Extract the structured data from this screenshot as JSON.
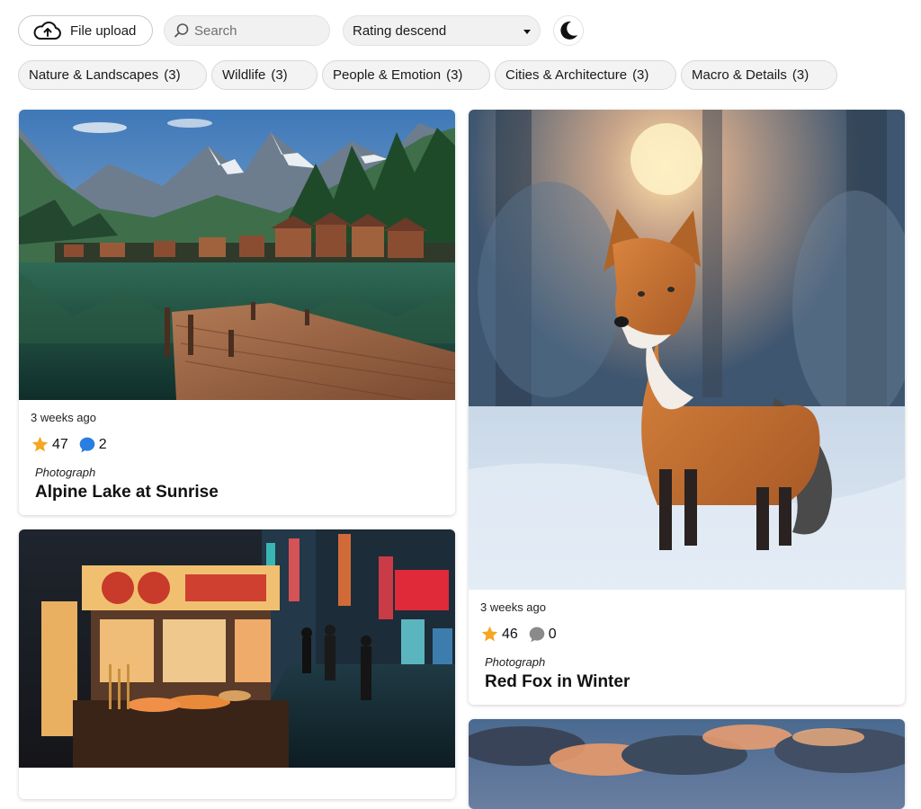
{
  "toolbar": {
    "upload_label": "File upload",
    "search_placeholder": "Search",
    "sort_value": "Rating descend"
  },
  "categories": [
    {
      "label": "Nature & Landscapes",
      "count": "(3)"
    },
    {
      "label": "Wildlife",
      "count": "(3)"
    },
    {
      "label": "People & Emotion",
      "count": "(3)"
    },
    {
      "label": "Cities & Architecture",
      "count": "(3)"
    },
    {
      "label": "Macro & Details",
      "count": "(3)"
    }
  ],
  "cards": [
    {
      "time": "3 weeks ago",
      "rating": "47",
      "comments": "2",
      "type": "Photograph",
      "title": "Alpine Lake at Sunrise",
      "comment_icon_color": "#2a7de1"
    },
    {
      "time": "3 weeks ago",
      "rating": "46",
      "comments": "0",
      "type": "Photograph",
      "title": "Red Fox in Winter",
      "comment_icon_color": "#8a8a8a"
    }
  ],
  "colors": {
    "star": "#f5a623",
    "comment_active": "#2a7de1",
    "comment_inactive": "#8a8a8a"
  }
}
